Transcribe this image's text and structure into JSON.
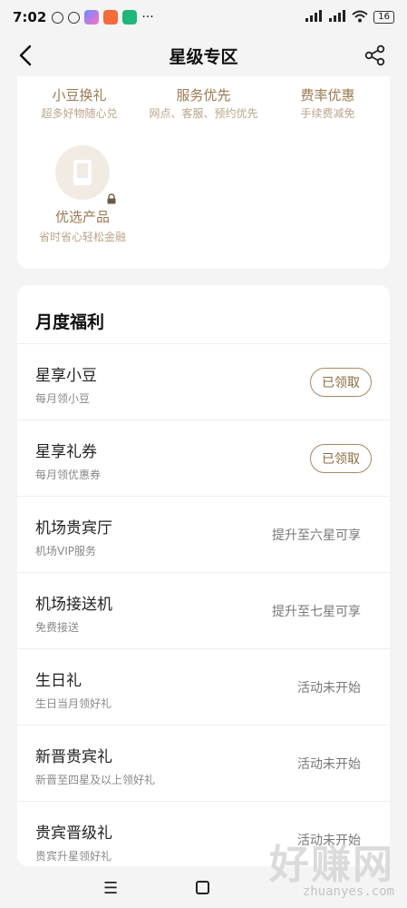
{
  "status_bar": {
    "time": "7:02",
    "menu_dots": "···",
    "battery": "16"
  },
  "header": {
    "title": "星级专区"
  },
  "privileges": [
    {
      "title": "小豆换礼",
      "sub": "超多好物随心兑"
    },
    {
      "title": "服务优先",
      "sub": "网点、客服、预约优先"
    },
    {
      "title": "费率优惠",
      "sub": "手续费减免"
    }
  ],
  "product": {
    "title": "优选产品",
    "sub": "省时省心轻松金融"
  },
  "monthly": {
    "title": "月度福利",
    "rows": [
      {
        "title": "星享小豆",
        "sub": "每月领小豆",
        "status": "已领取"
      },
      {
        "title": "星享礼券",
        "sub": "每月领优惠券",
        "status": "已领取"
      },
      {
        "title": "机场贵宾厅",
        "sub": "机场VIP服务",
        "status": "提升至六星可享"
      },
      {
        "title": "机场接送机",
        "sub": "免费接送",
        "status": "提升至七星可享"
      },
      {
        "title": "生日礼",
        "sub": "生日当月领好礼",
        "status": "活动未开始"
      },
      {
        "title": "新晋贵宾礼",
        "sub": "新晋至四星及以上领好礼",
        "status": "活动未开始"
      },
      {
        "title": "贵宾晋级礼",
        "sub": "贵宾升星领好礼",
        "status": "活动未开始"
      }
    ]
  },
  "watermark": {
    "main": "好赚网",
    "url": "zhuanyes.com"
  },
  "colors": {
    "accent": "#9a7a52",
    "pill_border": "#a9885d"
  }
}
